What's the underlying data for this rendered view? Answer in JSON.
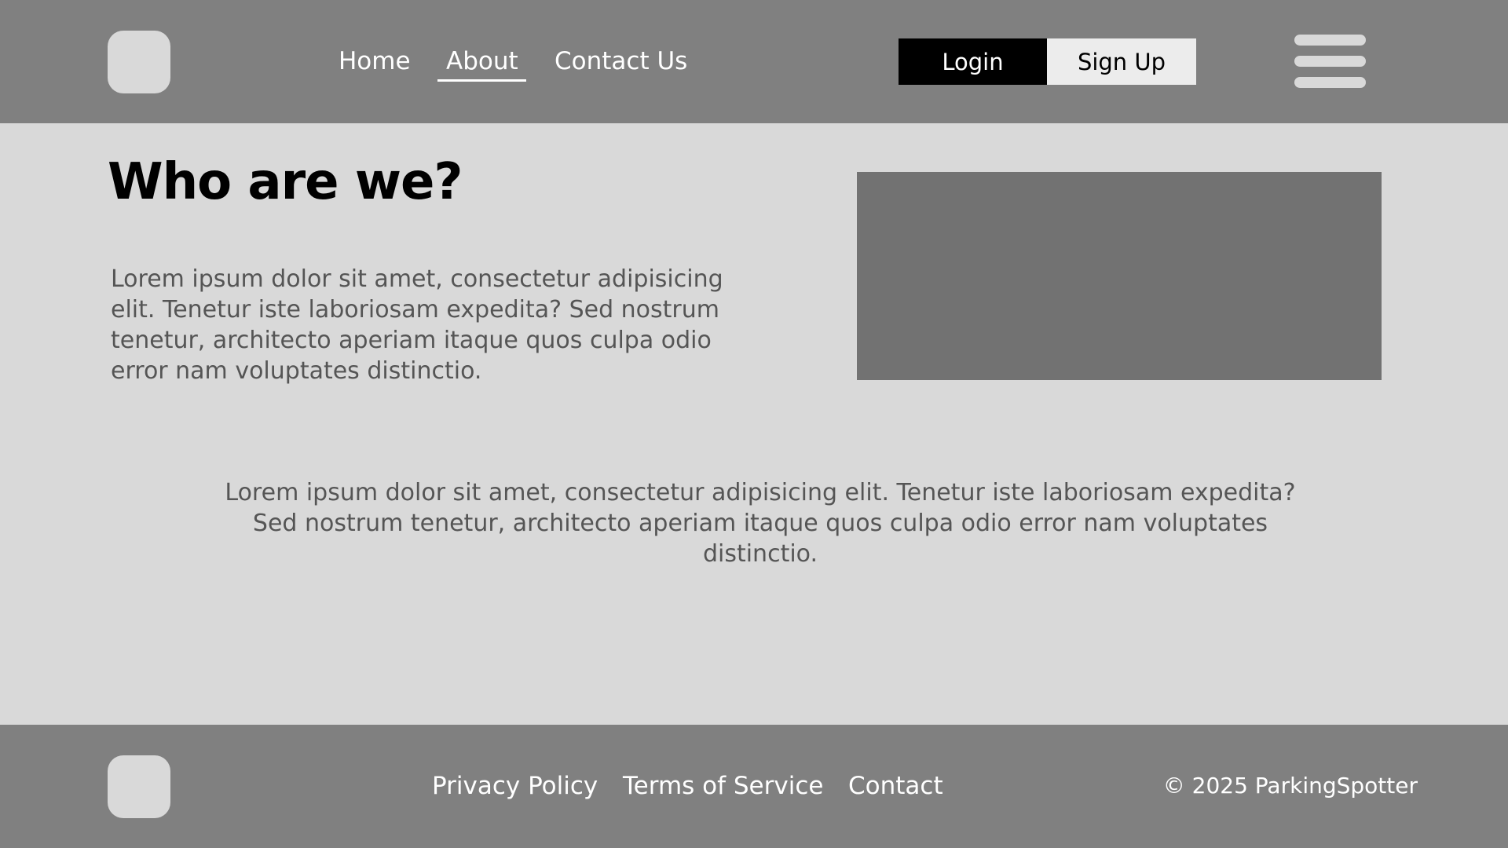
{
  "header": {
    "nav": {
      "home": "Home",
      "about": "About",
      "contact": "Contact Us"
    },
    "active_nav": "About",
    "login_label": "Login",
    "signup_label": "Sign Up"
  },
  "main": {
    "title": "Who are we?",
    "intro": "Lorem ipsum dolor sit amet, consectetur adipisicing elit. Tenetur iste laboriosam expedita? Sed nostrum tenetur, architecto aperiam itaque quos culpa odio error nam voluptates distinctio.",
    "body": "Lorem ipsum dolor sit amet, consectetur adipisicing elit. Tenetur iste laboriosam expedita? Sed nostrum tenetur, architecto aperiam itaque quos culpa odio error nam voluptates distinctio."
  },
  "footer": {
    "links": {
      "privacy": "Privacy Policy",
      "terms": "Terms of Service",
      "contact": "Contact"
    },
    "copyright": "© 2025 ParkingSpotter"
  },
  "colors": {
    "header_footer_bg": "#808080",
    "page_bg": "#d9d9d9",
    "login_bg": "#000000",
    "signup_bg": "#ececec",
    "image_placeholder": "#727272"
  },
  "icons": {
    "logo": "logo-placeholder",
    "menu": "hamburger-menu-icon"
  }
}
